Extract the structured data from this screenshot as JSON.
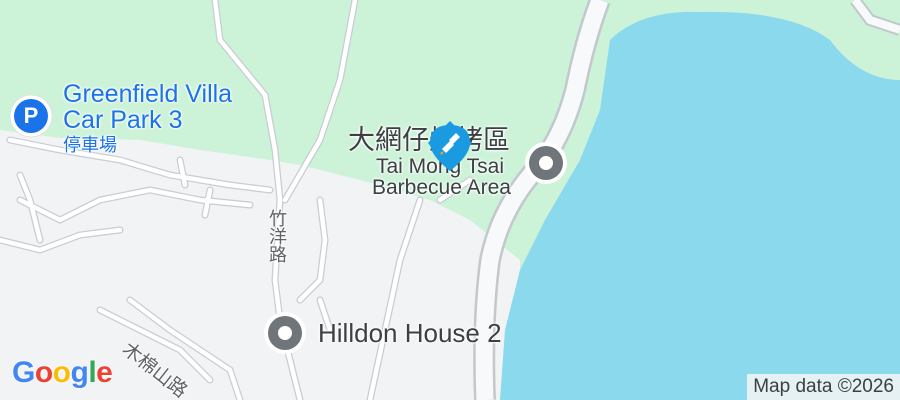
{
  "map": {
    "pois": {
      "car_park": {
        "name_line1": "Greenfield Villa",
        "name_line2": "Car Park 3",
        "name_zh": "停車場",
        "icon_letter": "P"
      },
      "bbq_area": {
        "name_zh": "大網仔燒烤區",
        "name_en_line1": "Tai Mong Tsai",
        "name_en_line2": "Barbecue Area"
      },
      "hilldon": {
        "name": "Hilldon House 2"
      }
    },
    "roads": {
      "chuk_yeung_road": "竹洋路",
      "muk_min_shan_road": "木棉山路"
    },
    "attribution": "Map data ©2026",
    "logo": {
      "letters": [
        "G",
        "o",
        "o",
        "g",
        "l",
        "e"
      ],
      "colors": [
        "#4285F4",
        "#EA4335",
        "#FBBC05",
        "#4285F4",
        "#34A853",
        "#EA4335"
      ]
    },
    "colors": {
      "water": "#8bd9ec",
      "park": "#ccf2d8",
      "land": "#f1f3f4",
      "road_border": "#c2c8cc",
      "poi_blue": "#1a73e8",
      "poi_gray": "#70757a",
      "pin_blue": "#1a9ae0"
    }
  }
}
